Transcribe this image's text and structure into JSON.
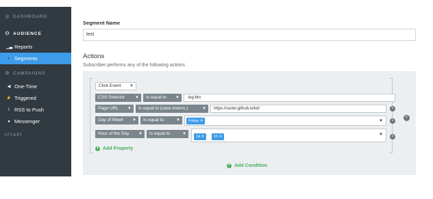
{
  "sidebar": {
    "dashboard": {
      "icon": "dashboard-icon",
      "label": "DASHBOARD"
    },
    "audience": {
      "icon": "audience-icon",
      "label": "AUDIENCE",
      "items": [
        {
          "icon": "reports-icon",
          "label": "Reports"
        },
        {
          "icon": "segments-icon",
          "label": "Segments"
        }
      ]
    },
    "campaigns": {
      "icon": "campaigns-icon",
      "label": "CAMPAIGNS",
      "items": [
        {
          "icon": "one-time-icon",
          "label": "One-Time"
        },
        {
          "icon": "triggered-icon",
          "label": "Triggered"
        },
        {
          "icon": "rss-icon",
          "label": "RSS to Push"
        },
        {
          "icon": "messenger-icon",
          "label": "Messenger"
        }
      ]
    },
    "api": {
      "icon": "code-icon",
      "label": "API"
    }
  },
  "segment_name": {
    "label": "Segment Name",
    "value": "test"
  },
  "actions": {
    "title": "Actions",
    "subtitle": "Subscriber performs any of the following actions",
    "event_select": "Click Event",
    "rows": [
      {
        "property": "CSS Selector",
        "operator": "Is equal to",
        "value": ".log-btn"
      },
      {
        "property": "Page URL",
        "operator": "Is equal to (case insens.)",
        "value": "https://raster.github.io/kd/"
      },
      {
        "property": "Day of Week",
        "operator": "Is equal to",
        "tags": [
          "Friday"
        ]
      },
      {
        "property": "Hour of the Day",
        "operator": "Is equal to",
        "tags": [
          "14",
          "15"
        ]
      }
    ],
    "add_property": "Add Property",
    "add_condition": "Add Condition"
  },
  "colors": {
    "sidebar_bg": "#303a40",
    "accent": "#3d9be9",
    "green": "#4cae5f",
    "panel_bg": "#eceff1"
  }
}
